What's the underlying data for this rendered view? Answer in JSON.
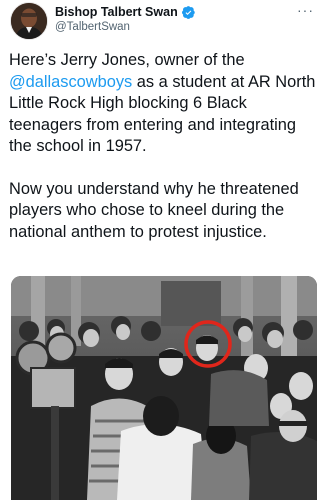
{
  "author": {
    "display_name": "Bishop Talbert Swan",
    "handle": "@TalbertSwan",
    "avatar_icon": "profile-avatar",
    "verified_icon": "verified-badge-icon",
    "verified_color": "#1d9bf0"
  },
  "menu": {
    "more_label": "···"
  },
  "tweet": {
    "p1_before": "Here’s Jerry Jones, owner of the ",
    "mention": "@dallascowboys",
    "p1_after": " as a student at AR North Little Rock High blocking 6 Black teenagers from entering and integrating the school in 1957.",
    "p2": "Now you understand why he threatened players who chose to kneel during the national anthem to protest injustice."
  },
  "media": {
    "type": "black-and-white photo",
    "highlight_color": "#e0261b"
  },
  "colors": {
    "link": "#1d9bf0",
    "text": "#0f1419",
    "secondary": "#536471"
  }
}
